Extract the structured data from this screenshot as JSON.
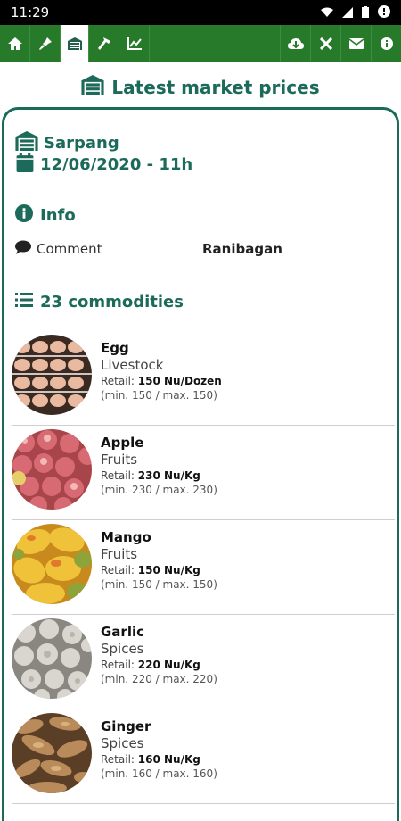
{
  "status": {
    "time": "11:29"
  },
  "toolbar": {
    "left_icons": [
      "home-icon",
      "pin-icon",
      "market-icon",
      "hammer-icon",
      "chart-icon"
    ],
    "right_icons": [
      "cloud-download-icon",
      "tools-icon",
      "mail-icon",
      "info-icon"
    ]
  },
  "title": "Latest market prices",
  "market": {
    "name": "Sarpang",
    "date": "12/06/2020 - 11h"
  },
  "info": {
    "heading": "Info",
    "comment_label": "Comment",
    "comment_value": "Ranibagan"
  },
  "commodities": {
    "heading": "23 commodities",
    "items": [
      {
        "name": "Egg",
        "category": "Livestock",
        "retail_label": "Retail:",
        "retail": "150 Nu/Dozen",
        "range": "(min. 150 / max. 150)"
      },
      {
        "name": "Apple",
        "category": "Fruits",
        "retail_label": "Retail:",
        "retail": "230 Nu/Kg",
        "range": "(min. 230 / max. 230)"
      },
      {
        "name": "Mango",
        "category": "Fruits",
        "retail_label": "Retail:",
        "retail": "150 Nu/Kg",
        "range": "(min. 150 / max. 150)"
      },
      {
        "name": "Garlic",
        "category": "Spices",
        "retail_label": "Retail:",
        "retail": "220 Nu/Kg",
        "range": "(min. 220 / max. 220)"
      },
      {
        "name": "Ginger",
        "category": "Spices",
        "retail_label": "Retail:",
        "retail": "160 Nu/Kg",
        "range": "(min. 160 / max. 160)"
      }
    ]
  },
  "colors": {
    "primary": "#1b6a5a",
    "toolbar": "#267a2a"
  }
}
